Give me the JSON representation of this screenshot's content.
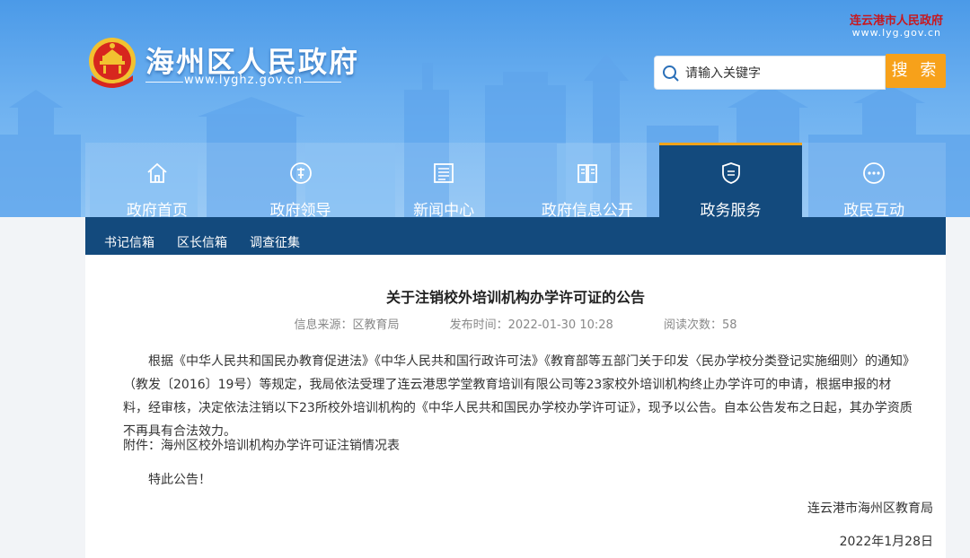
{
  "header": {
    "site_title": "海州区人民政府",
    "site_url": "www.lyghz.gov.cn",
    "city_name": "连云港市人民政府",
    "city_url": "www.lyg.gov.cn",
    "emblem_icon": "national-emblem-icon"
  },
  "search": {
    "placeholder": "请输入关键字",
    "button_label": "搜 索",
    "icon": "search-icon"
  },
  "nav": {
    "items": [
      {
        "label": "政府首页",
        "icon": "home-icon"
      },
      {
        "label": "政府领导",
        "icon": "leader-icon"
      },
      {
        "label": "新闻中心",
        "icon": "news-icon"
      },
      {
        "label": "政府信息公开",
        "icon": "book-icon"
      },
      {
        "label": "政务服务",
        "icon": "shield-icon",
        "active": true
      },
      {
        "label": "政民互动",
        "icon": "chat-icon"
      }
    ]
  },
  "subnav": {
    "items": [
      "书记信箱",
      "区长信箱",
      "调查征集"
    ]
  },
  "article": {
    "title": "关于注销校外培训机构办学许可证的公告",
    "source": "信息来源：区教育局",
    "published": "发布时间：2022-01-30 10:28",
    "views": "阅读次数：58",
    "body": "根据《中华人民共和国民办教育促进法》《中华人民共和国行政许可法》《教育部等五部门关于印发〈民办学校分类登记实施细则〉的通知》（教发〔2016〕19号）等规定，我局依法受理了连云港思学堂教育培训有限公司等23家校外培训机构终止办学许可的申请，根据申报的材料，经审核，决定依法注销以下23所校外培训机构的《中华人民共和国民办学校办学许可证》，现予以公告。自本公告发布之日起，其办学资质不再具有合法效力。",
    "attachment": "附件：海州区校外培训机构办学许可证注销情况表",
    "notice": "特此公告！",
    "signer": "连云港市海州区教育局",
    "date": "2022年1月28日"
  },
  "colors": {
    "banner_top": "#4b9ae8",
    "nav_active": "#134a7d",
    "accent": "#f7a11a",
    "city_name": "#c8171e"
  }
}
